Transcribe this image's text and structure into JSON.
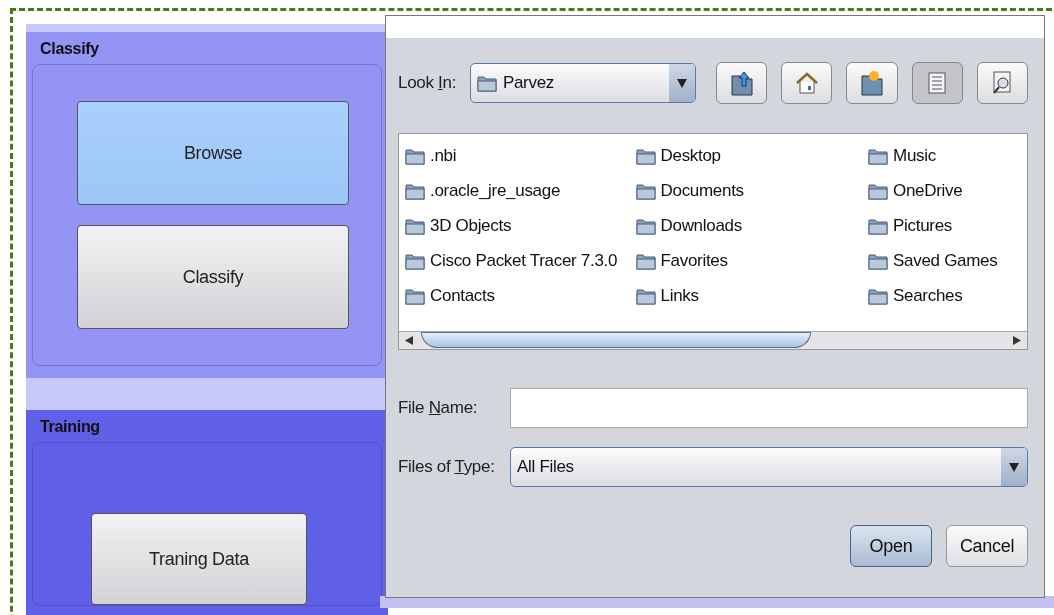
{
  "sections": [
    {
      "title": "Classify",
      "kind": "classify",
      "buttons": [
        {
          "label": "Browse",
          "selected": true
        },
        {
          "label": "Classify",
          "selected": false
        }
      ]
    },
    {
      "title": "Training",
      "kind": "training",
      "buttons": [
        {
          "label": "Traning Data",
          "selected": false
        }
      ]
    }
  ],
  "dialog": {
    "look_in": {
      "label": {
        "before": "Look ",
        "key": "I",
        "after": "n:"
      },
      "value": "Parvez"
    },
    "toolbar": [
      {
        "kind": "up",
        "selected": false
      },
      {
        "kind": "home",
        "selected": false
      },
      {
        "kind": "new-folder",
        "selected": false
      },
      {
        "kind": "list",
        "selected": true
      },
      {
        "kind": "details",
        "selected": false
      }
    ],
    "files": [
      [
        ".nbi",
        ".oracle_jre_usage",
        "3D Objects",
        "Cisco Packet Tracer 7.3.0",
        "Contacts"
      ],
      [
        "Desktop",
        "Documents",
        "Downloads",
        "Favorites",
        "Links"
      ],
      [
        "Music",
        "OneDrive",
        "Pictures",
        "Saved Games",
        "Searches"
      ]
    ],
    "file_name": {
      "label": {
        "before": "File ",
        "key": "N",
        "after": "ame:"
      }
    },
    "file_type": {
      "label": {
        "before": "Files of ",
        "key": "T",
        "after": "ype:"
      },
      "value": "All Files"
    },
    "buttons": [
      {
        "label": "Open",
        "selected": true
      },
      {
        "label": "Cancel",
        "selected": false
      }
    ]
  }
}
